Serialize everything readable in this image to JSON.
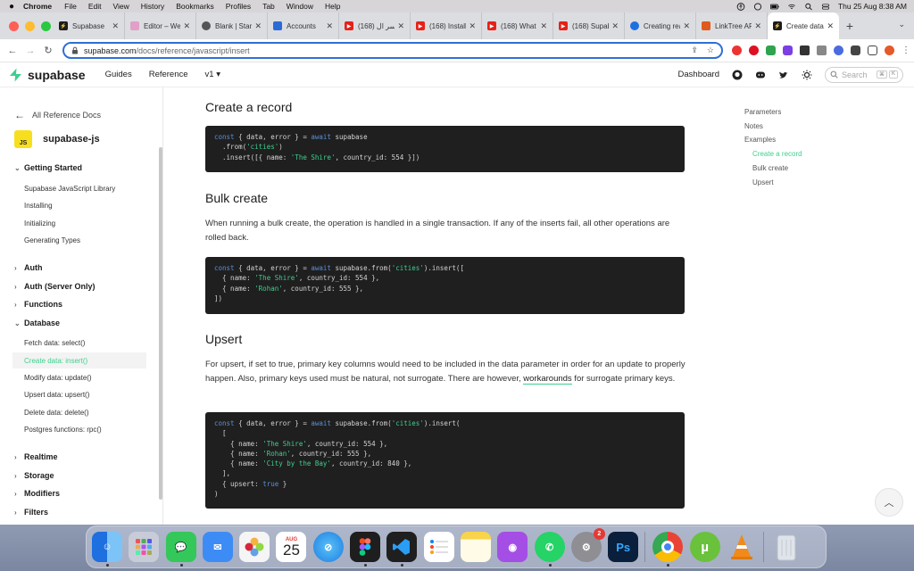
{
  "menubar": {
    "app": "Chrome",
    "items": [
      "File",
      "Edit",
      "View",
      "History",
      "Bookmarks",
      "Profiles",
      "Tab",
      "Window",
      "Help"
    ],
    "datetime": "Thu 25 Aug  8:38 AM"
  },
  "tabs": [
    {
      "title": "Supabase",
      "color": "#1c1c1c"
    },
    {
      "title": "Editor – Web",
      "color": "#e0a0c8"
    },
    {
      "title": "Blank | Start",
      "color": "#555555"
    },
    {
      "title": "Accounts",
      "color": "#2c6bd6"
    },
    {
      "title": "(168) ياسر ال",
      "color": "#e62117"
    },
    {
      "title": "(168) Install",
      "color": "#e62117"
    },
    {
      "title": "(168) What",
      "color": "#e62117"
    },
    {
      "title": "(168) Supab",
      "color": "#e62117"
    },
    {
      "title": "Creating rea",
      "color": "#1f6fe0"
    },
    {
      "title": "LinkTree AP",
      "color": "#e05a1f"
    },
    {
      "title": "Create data",
      "color": "#1c1c1c",
      "active": true
    }
  ],
  "address": {
    "host": "supabase.com",
    "path": "/docs/reference/javascript/insert"
  },
  "header": {
    "brand": "supabase",
    "links": [
      "Guides",
      "Reference",
      "v1 ▾"
    ],
    "dashboard": "Dashboard",
    "search_placeholder": "Search",
    "kbd": [
      "⌘",
      "K"
    ]
  },
  "sidebar": {
    "back": "All Reference Docs",
    "lib_badge": "JS",
    "lib_name": "supabase-js",
    "sections": [
      {
        "label": "Getting Started",
        "expanded": true
      },
      {
        "label": "Auth",
        "expanded": false
      },
      {
        "label": "Auth (Server Only)",
        "expanded": false
      },
      {
        "label": "Functions",
        "expanded": false
      },
      {
        "label": "Database",
        "expanded": true
      },
      {
        "label": "Realtime",
        "expanded": false
      },
      {
        "label": "Storage",
        "expanded": false
      },
      {
        "label": "Modifiers",
        "expanded": false
      },
      {
        "label": "Filters",
        "expanded": false
      }
    ],
    "getting_started_items": [
      "Supabase JavaScript Library",
      "Installing",
      "Initializing",
      "Generating Types"
    ],
    "database_items": [
      "Fetch data: select()",
      "Create data: insert()",
      "Modify data: update()",
      "Upsert data: upsert()",
      "Delete data: delete()",
      "Postgres functions: rpc()"
    ],
    "active_item": "Create data: insert()"
  },
  "main": {
    "create_title": "Create a record",
    "create_code": [
      "const { data, error } = await supabase",
      "  .from('cities')",
      "  .insert([{ name: 'The Shire', country_id: 554 }])"
    ],
    "bulk_title": "Bulk create",
    "bulk_text": "When running a bulk create, the operation is handled in a single transaction. If any of the inserts fail, all other operations are rolled back.",
    "bulk_code": [
      "const { data, error } = await supabase.from('cities').insert([",
      "  { name: 'The Shire', country_id: 554 },",
      "  { name: 'Rohan', country_id: 555 },",
      "])"
    ],
    "upsert_title": "Upsert",
    "upsert_text_1": "For upsert, if set to true, primary key columns would need to be included in the data parameter in order for an update to properly happen. Also, primary keys used must be natural, not surrogate. There are however, ",
    "upsert_link": "workarounds",
    "upsert_text_2": " for surrogate primary keys.",
    "upsert_code": [
      "const { data, error } = await supabase.from('cities').insert(",
      "  [",
      "    { name: 'The Shire', country_id: 554 },",
      "    { name: 'Rohan', country_id: 555 },",
      "    { name: 'City by the Bay', country_id: 840 },",
      "  ],",
      "  { upsert: true }",
      ")"
    ]
  },
  "toc": {
    "items": [
      "Parameters",
      "Notes",
      "Examples"
    ],
    "sub_items": [
      "Create a record",
      "Bulk create",
      "Upsert"
    ],
    "active": "Create a record"
  },
  "dock": {
    "apps": [
      {
        "name": "Finder",
        "color": "#3a8ff0"
      },
      {
        "name": "Launchpad",
        "color": "#c7ccd8"
      },
      {
        "name": "Messages",
        "color": "#34c759"
      },
      {
        "name": "Mail",
        "color": "#3d8cf5"
      },
      {
        "name": "Photos",
        "color": "#f5f5f5"
      },
      {
        "name": "Calendar",
        "color": "#ffffff"
      },
      {
        "name": "Safari",
        "color": "#2f9ef5"
      },
      {
        "name": "Figma",
        "color": "#1e1e1e"
      },
      {
        "name": "VS Code",
        "color": "#0f6fc6"
      },
      {
        "name": "Reminders",
        "color": "#ffffff"
      },
      {
        "name": "Notes",
        "color": "#f9d34a"
      },
      {
        "name": "Podcasts",
        "color": "#a44ee6"
      },
      {
        "name": "WhatsApp",
        "color": "#25d366"
      },
      {
        "name": "System Settings",
        "color": "#8e8e93"
      },
      {
        "name": "Photoshop",
        "color": "#0a1f3b"
      },
      {
        "name": "Chrome",
        "color": "#ffffff"
      },
      {
        "name": "uTorrent",
        "color": "#6ac13c"
      },
      {
        "name": "VLC",
        "color": "#f08a1b"
      },
      {
        "name": "Trash",
        "color": "#dfe3ea"
      }
    ],
    "calendar_month": "AUG",
    "calendar_day": "25",
    "settings_badge": "2",
    "photoshop_label": "Ps"
  }
}
